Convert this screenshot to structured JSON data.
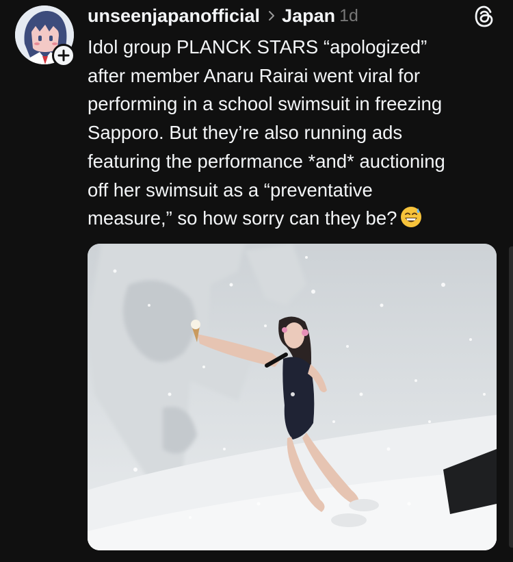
{
  "post": {
    "username": "unseenjapanofficial",
    "topic": "Japan",
    "timestamp": "1d",
    "body_lines": [
      "Idol group PLANCK STARS “apologized”",
      "after member Anaru Rairai went viral for",
      "performing in a school swimsuit in freezing",
      "Sapporo. But they’re also running ads",
      "featuring the performance *and* auctioning",
      "off her swimsuit as a “preventative",
      "measure,” so how sorry can they be?"
    ],
    "emoji_name": "grinning-face-with-sweat-emoji",
    "media_alt": "performer in snowstorm"
  },
  "icons": {
    "avatar": "avatar-illustration",
    "follow": "plus-icon",
    "chevron": "chevron-right-icon",
    "app": "threads-logo-icon"
  },
  "colors": {
    "background": "#101010",
    "text_primary": "#f3f5f7",
    "text_secondary": "#777777"
  }
}
